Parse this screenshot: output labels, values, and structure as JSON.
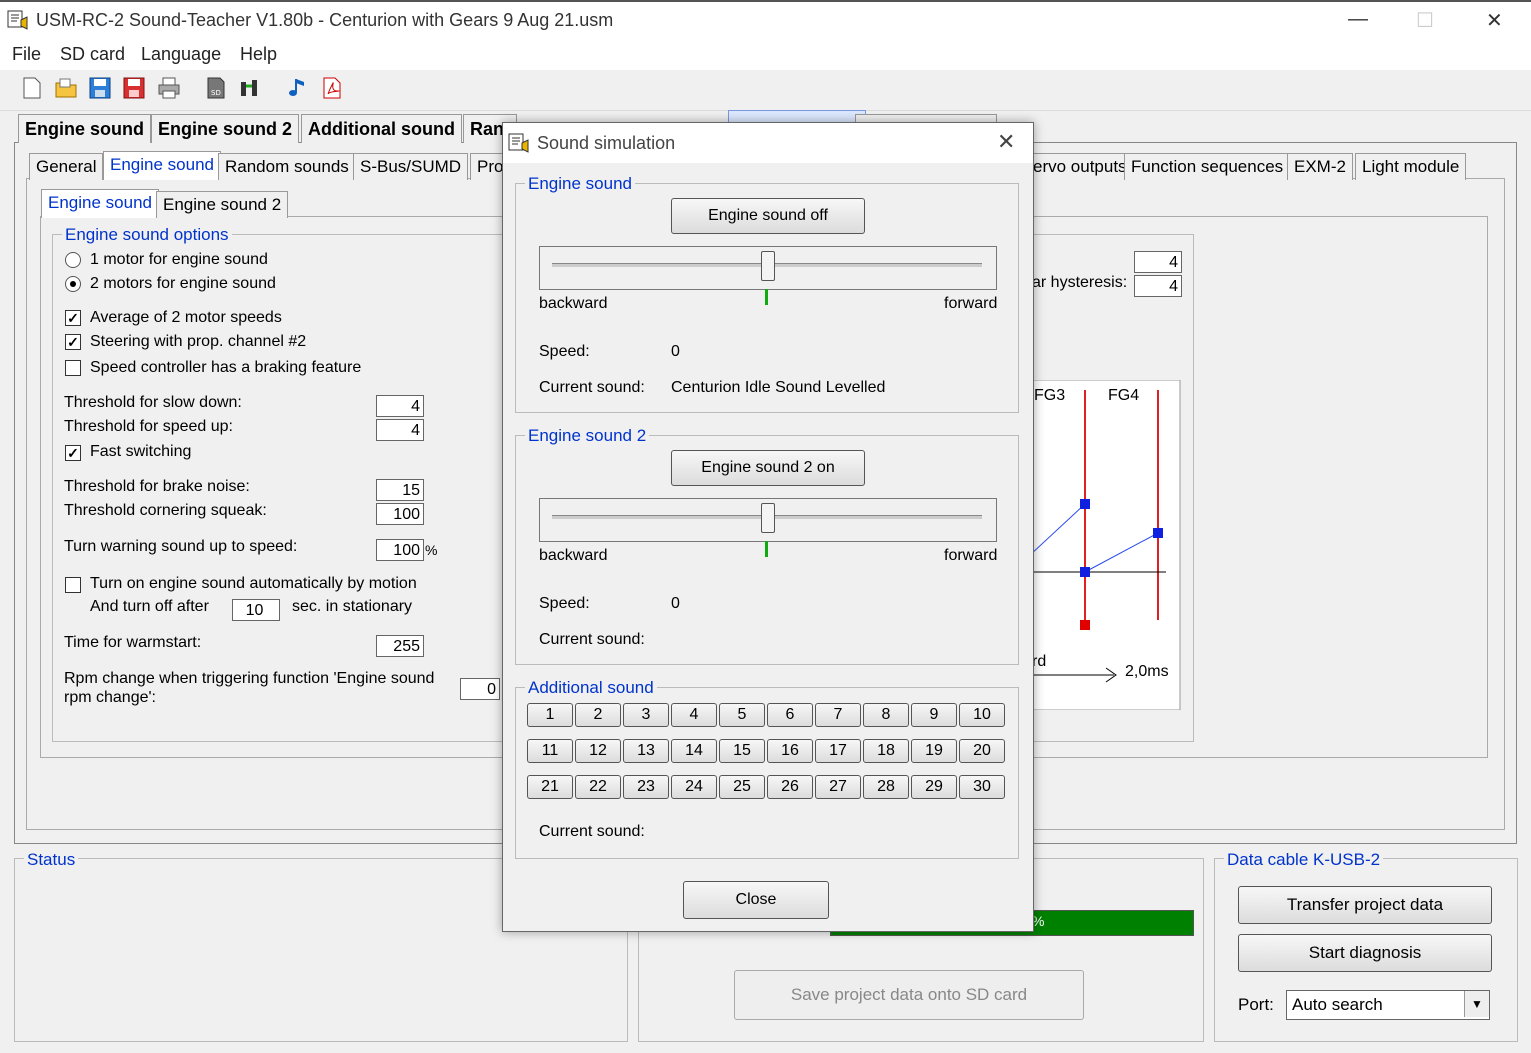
{
  "window": {
    "title": "USM-RC-2 Sound-Teacher V1.80b - Centurion with Gears 9 Aug 21.usm"
  },
  "menu": [
    "File",
    "SD card",
    "Language",
    "Help"
  ],
  "top_tabs": [
    "Engine sound",
    "Engine sound 2",
    "Additional sound",
    "Ran"
  ],
  "mid_tabs": [
    "General",
    "Engine sound",
    "Random sounds",
    "S-Bus/SUMD",
    "Pro",
    "ervo outputs",
    "Function sequences",
    "EXM-2",
    "Light module"
  ],
  "sub_tabs": [
    "Engine sound",
    "Engine sound 2"
  ],
  "options": {
    "legend": "Engine sound options",
    "radio1": "1 motor for engine sound",
    "radio2": "2 motors for engine sound",
    "chk_avg": "Average of 2 motor speeds",
    "chk_steer": "Steering with prop. channel #2",
    "chk_brake": "Speed controller has a braking feature",
    "thr_slow_label": "Threshold for slow down:",
    "thr_slow": "4",
    "thr_up_label": "Threshold for speed up:",
    "thr_up": "4",
    "fast_switch": "Fast switching",
    "brake_noise_label": "Threshold for brake noise:",
    "brake_noise": "15",
    "corner_label": "Threshold cornering squeak:",
    "corner": "100",
    "turn_label": "Turn warning sound up to speed:",
    "turn": "100",
    "turn_unit": "%",
    "auto_on": "Turn on engine sound automatically by motion",
    "turn_off_pre": "And turn off after",
    "turn_off_val": "10",
    "turn_off_post": "sec. in stationary",
    "warm_label": "Time for warmstart:",
    "warm": "255",
    "rpm_label_1": "Rpm change when triggering function 'Engine sound",
    "rpm_label_2": "rpm change':",
    "rpm_val": "0"
  },
  "right_panel": {
    "hyst_label": "ar hysteresis:",
    "val1": "4",
    "val2": "4",
    "fg3": "FG3",
    "fg4": "FG4",
    "axis_left": "rd",
    "axis_right": "2,0ms"
  },
  "status": {
    "legend": "Status",
    "percent": "%"
  },
  "sd_button": "Save project data onto SD card",
  "data_cable": {
    "legend": "Data cable K-USB-2",
    "transfer": "Transfer project data",
    "diag": "Start diagnosis",
    "port_label": "Port:",
    "port_value": "Auto search"
  },
  "dialog": {
    "title": "Sound simulation",
    "engine": {
      "legend": "Engine sound",
      "button": "Engine sound off",
      "backward": "backward",
      "forward": "forward",
      "speed_label": "Speed:",
      "speed": "0",
      "cur_label": "Current sound:",
      "cur": "Centurion Idle Sound Levelled",
      "position": 0.5
    },
    "engine2": {
      "legend": "Engine sound 2",
      "button": "Engine sound 2 on",
      "backward": "backward",
      "forward": "forward",
      "speed_label": "Speed:",
      "speed": "0",
      "cur_label": "Current sound:",
      "cur": "",
      "position": 0.5
    },
    "additional": {
      "legend": "Additional sound",
      "buttons": [
        "1",
        "2",
        "3",
        "4",
        "5",
        "6",
        "7",
        "8",
        "9",
        "10",
        "11",
        "12",
        "13",
        "14",
        "15",
        "16",
        "17",
        "18",
        "19",
        "20",
        "21",
        "22",
        "23",
        "24",
        "25",
        "26",
        "27",
        "28",
        "29",
        "30"
      ],
      "cur_label": "Current sound:"
    },
    "close": "Close"
  },
  "colors": {
    "accent": "#0033cc",
    "progress": "#008000",
    "red_line": "#e02020",
    "blue_line": "#2a4af0"
  }
}
